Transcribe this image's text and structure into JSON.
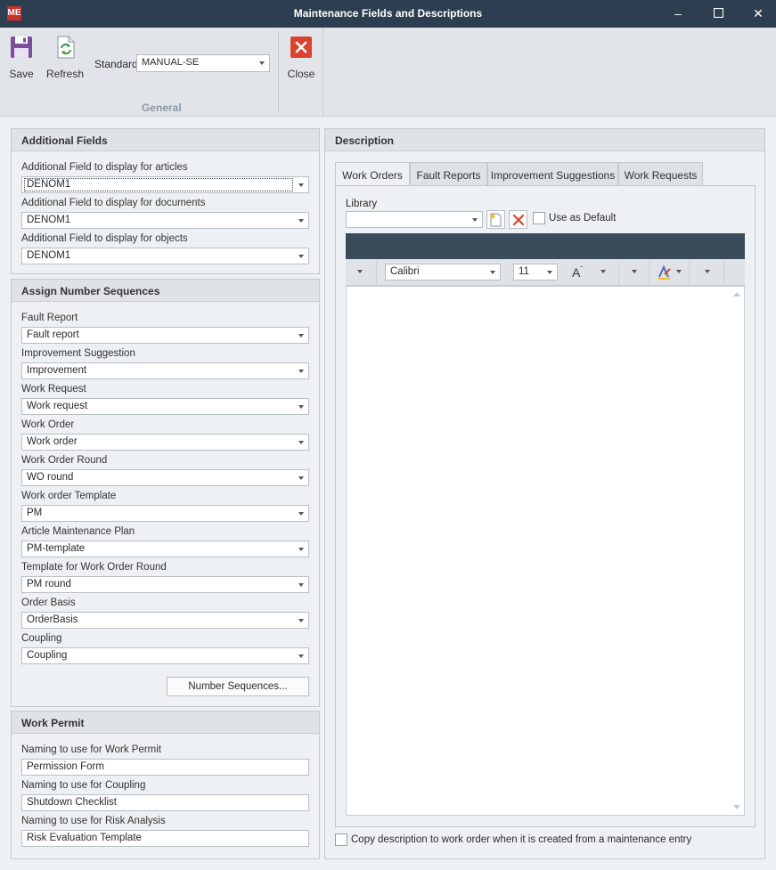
{
  "window": {
    "app_icon": "ME",
    "title": "Maintenance Fields and Descriptions",
    "minimize": "–",
    "maximize": "☐",
    "close": "✕"
  },
  "ribbon": {
    "save_label": "Save",
    "refresh_label": "Refresh",
    "standard_label": "Standard",
    "standard_value": "MANUAL-SE",
    "close_label": "Close",
    "group_label": "General"
  },
  "additional_fields": {
    "header": "Additional Fields",
    "fields": [
      {
        "label": "Additional Field to display for articles",
        "value": "DENOM1"
      },
      {
        "label": "Additional Field to display for documents",
        "value": "DENOM1"
      },
      {
        "label": "Additional Field to display for objects",
        "value": "DENOM1"
      }
    ]
  },
  "number_sequences": {
    "header": "Assign Number Sequences",
    "fields": [
      {
        "label": "Fault Report",
        "value": "Fault report"
      },
      {
        "label": "Improvement Suggestion",
        "value": "Improvement"
      },
      {
        "label": "Work Request",
        "value": "Work request"
      },
      {
        "label": "Work Order",
        "value": "Work order"
      },
      {
        "label": "Work Order Round",
        "value": "WO round"
      },
      {
        "label": "Work order Template",
        "value": "PM"
      },
      {
        "label": "Article Maintenance Plan",
        "value": "PM-template"
      },
      {
        "label": "Template for Work Order Round",
        "value": "PM round"
      },
      {
        "label": "Order Basis",
        "value": "OrderBasis"
      },
      {
        "label": "Coupling",
        "value": "Coupling"
      }
    ],
    "button_label": "Number Sequences..."
  },
  "work_permit": {
    "header": "Work Permit",
    "fields": [
      {
        "label": "Naming to use for Work Permit",
        "value": "Permission Form"
      },
      {
        "label": "Naming to use for Coupling",
        "value": "Shutdown Checklist"
      },
      {
        "label": "Naming to use for Risk Analysis",
        "value": "Risk Evaluation Template"
      }
    ]
  },
  "description": {
    "header": "Description",
    "tabs": [
      "Work Orders",
      "Fault Reports",
      "Improvement Suggestions",
      "Work Requests"
    ],
    "library_label": "Library",
    "library_value": "",
    "use_as_default_label": "Use as Default",
    "font_name": "Calibri",
    "font_size": "11",
    "font_grow_glyph": "A",
    "copy_checkbox_label": "Copy description to work order when it is created from a maintenance entry"
  },
  "colors": {
    "titlebar": "#2d3e50",
    "close_red": "#d9432f",
    "accent_purple": "#7a4fa0"
  }
}
